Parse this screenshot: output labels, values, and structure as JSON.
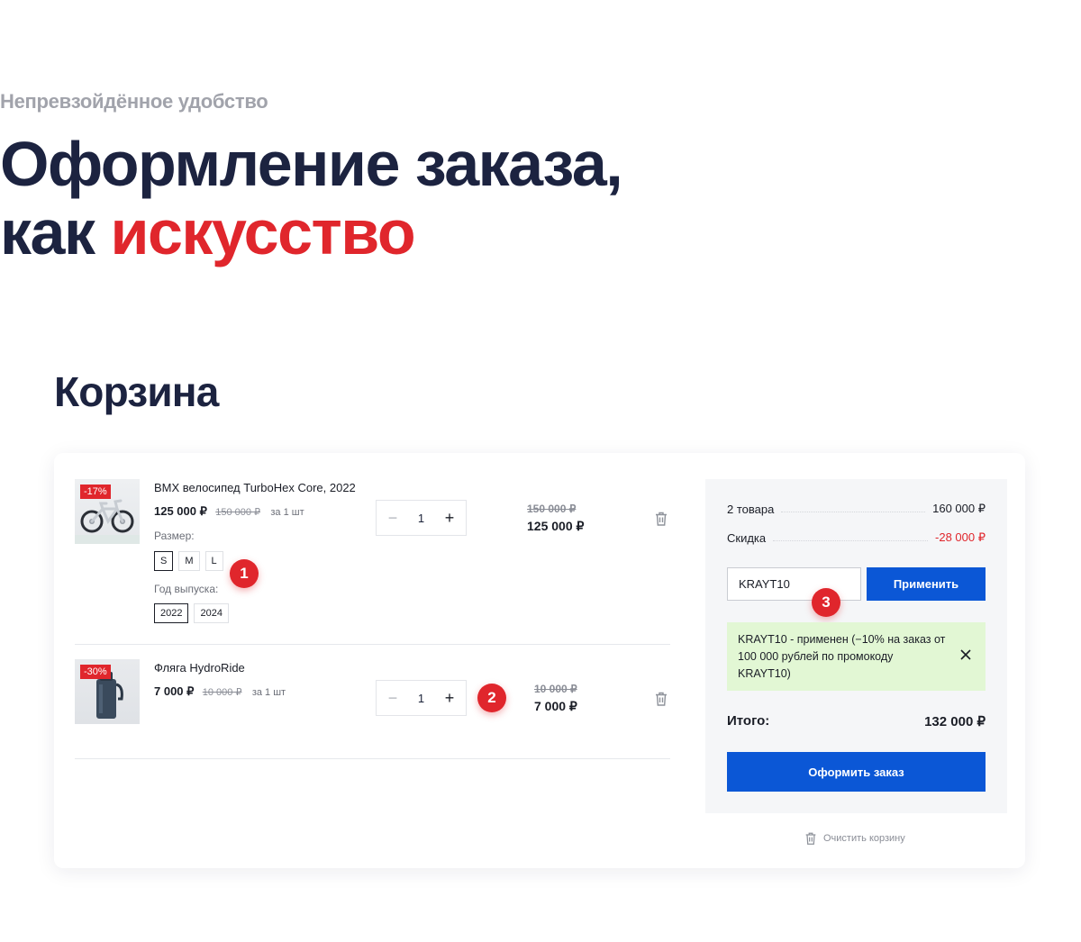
{
  "hero": {
    "eyebrow": "Непревзойдённое удобство",
    "line1": "Оформление заказа,",
    "line2_prefix": "как ",
    "line2_accent": "искусство"
  },
  "cart": {
    "title": "Корзина",
    "items": [
      {
        "name": "BMX велосипед TurboHex Core, 2022",
        "discount_badge": "-17%",
        "price": "125 000 ₽",
        "old_price": "150 000 ₽",
        "per_unit": "за 1 шт",
        "options": [
          {
            "label": "Размер:",
            "chips": [
              "S",
              "M",
              "L"
            ],
            "selected": "S"
          },
          {
            "label": "Год выпуска:",
            "chips": [
              "2022",
              "2024"
            ],
            "selected": "2022"
          }
        ],
        "quantity": "1",
        "sum_old": "150 000 ₽",
        "sum": "125 000 ₽",
        "image": "bmx-bike"
      },
      {
        "name": "Фляга HydroRide",
        "discount_badge": "-30%",
        "price": "7 000 ₽",
        "old_price": "10 000 ₽",
        "per_unit": "за 1 шт",
        "quantity": "1",
        "sum_old": "10 000 ₽",
        "sum": "7 000 ₽",
        "image": "water-flask"
      }
    ],
    "markers": [
      "1",
      "2",
      "3"
    ],
    "summary": {
      "items_label": "2 товара",
      "items_total": "160 000 ₽",
      "discount_label": "Скидка",
      "discount_value": "-28 000 ₽",
      "promo_value": "KRAYT10",
      "apply_label": "Применить",
      "promo_note": "KRAYT10 - применен (−10% на заказ от 100 000 рублей по промокоду KRAYT10)",
      "total_label": "Итого:",
      "total_value": "132 000 ₽",
      "checkout_label": "Оформить заказ"
    },
    "clear_label": "Очистить корзину"
  },
  "colors": {
    "accent_red": "#e0262c",
    "primary_blue": "#0b57d6",
    "heading": "#1c2340",
    "success_bg": "#e2f7d4"
  }
}
